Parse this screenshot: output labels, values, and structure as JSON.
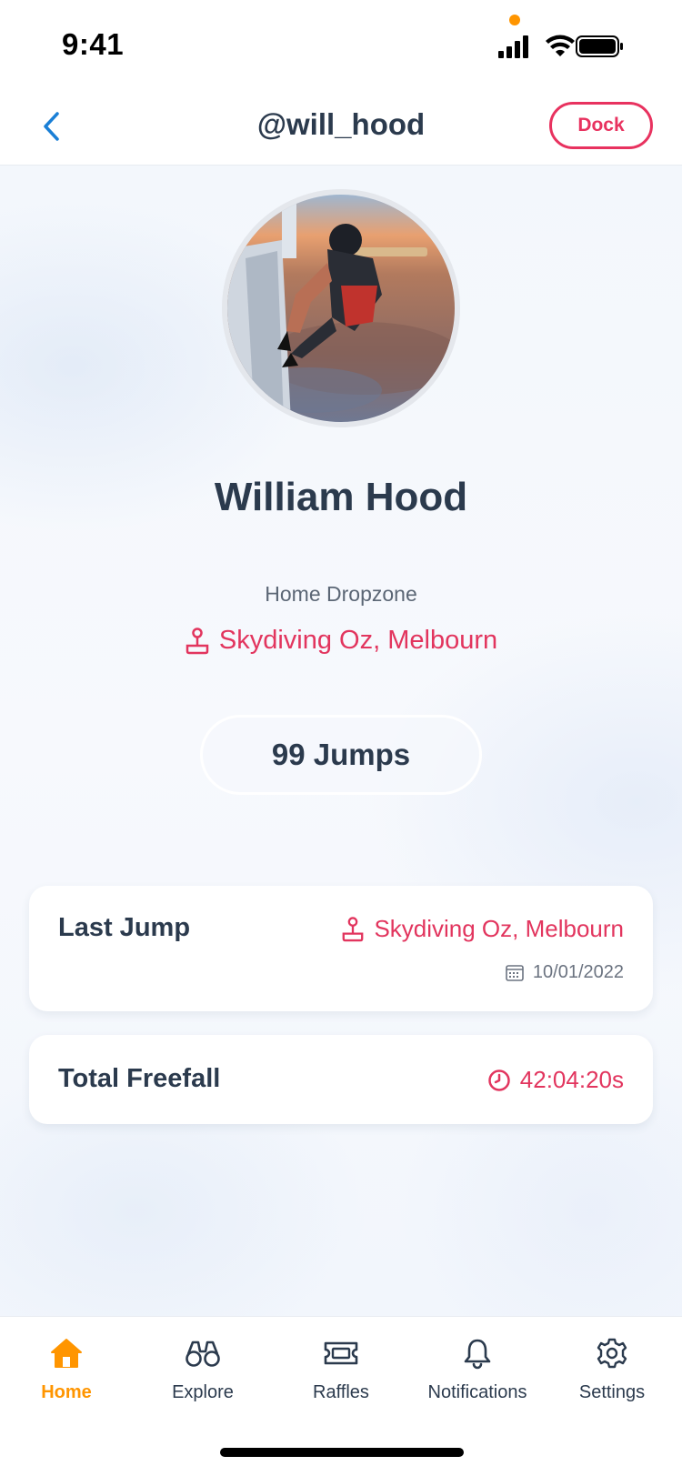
{
  "status_bar": {
    "time": "9:41"
  },
  "header": {
    "title": "@will_hood",
    "back_icon": "chevron-left-icon",
    "dock_label": "Dock"
  },
  "profile": {
    "name": "William Hood",
    "avatar_alt": "Skydiver exiting an aircraft",
    "dropzone_label": "Home Dropzone",
    "dropzone_name": "Skydiving Oz, Melbourn",
    "jumps": "99 Jumps"
  },
  "cards": {
    "last_jump": {
      "title": "Last Jump",
      "location": "Skydiving Oz, Melbourn",
      "date": "10/01/2022"
    },
    "total_freefall": {
      "title": "Total Freefall",
      "time": "42:04:20s"
    }
  },
  "tab_bar": {
    "items": [
      {
        "label": "Home",
        "icon": "home-icon",
        "active": true
      },
      {
        "label": "Explore",
        "icon": "binoculars-icon",
        "active": false
      },
      {
        "label": "Raffles",
        "icon": "ticket-icon",
        "active": false
      },
      {
        "label": "Notifications",
        "icon": "bell-icon",
        "active": false
      },
      {
        "label": "Settings",
        "icon": "gear-icon",
        "active": false
      }
    ]
  },
  "colors": {
    "accent_red": "#e2355e",
    "active_tab": "#ff9500",
    "text_dark": "#2b3a4d",
    "back_blue": "#1a7fd6"
  }
}
